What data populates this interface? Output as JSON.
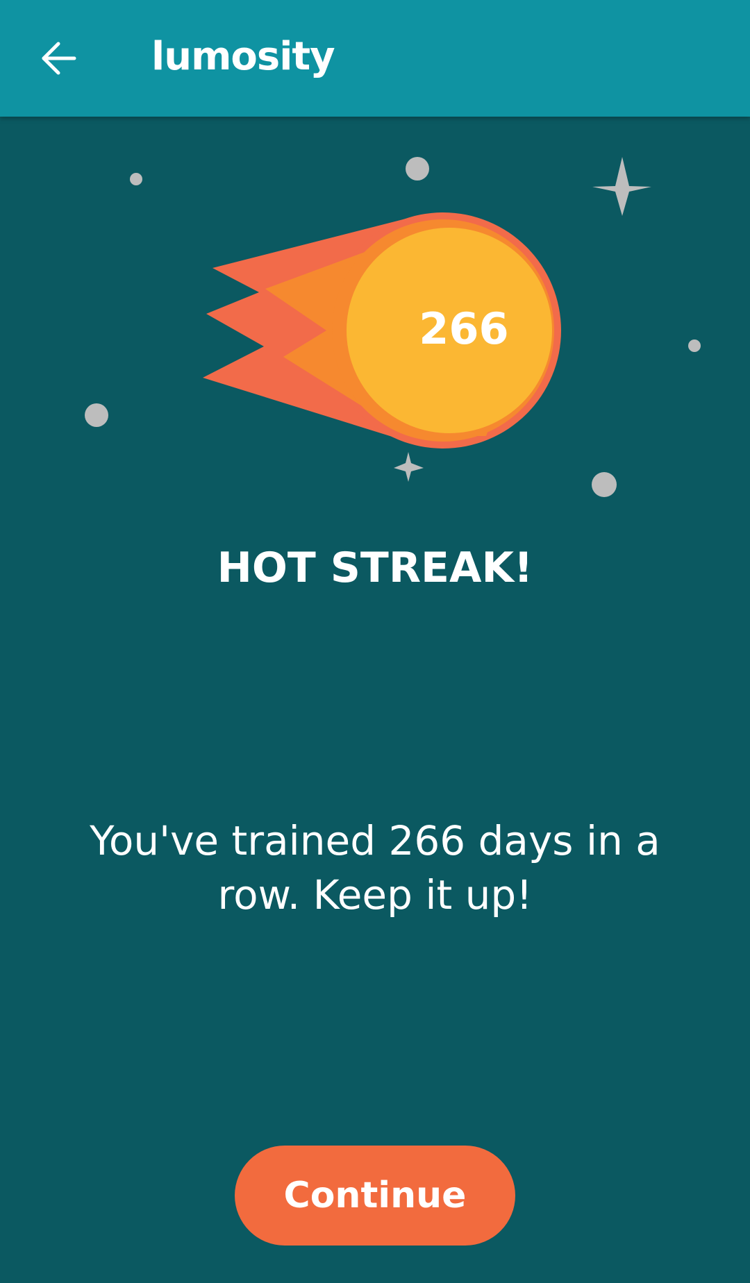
{
  "app_bar": {
    "title": "lumosity",
    "back_icon": "arrow-left-icon"
  },
  "streak": {
    "days": "266",
    "headline": "HOT STREAK!",
    "message": "You've trained 266 days in a row. Keep it up!"
  },
  "actions": {
    "continue_label": "Continue"
  },
  "colors": {
    "app_bar": "#0f93a2",
    "background": "#0b5961",
    "fireball_outer": "#f26b4a",
    "fireball_mid": "#f6892f",
    "fireball_core": "#fbb733",
    "star": "#bdbdbd",
    "button": "#f26b3e"
  }
}
